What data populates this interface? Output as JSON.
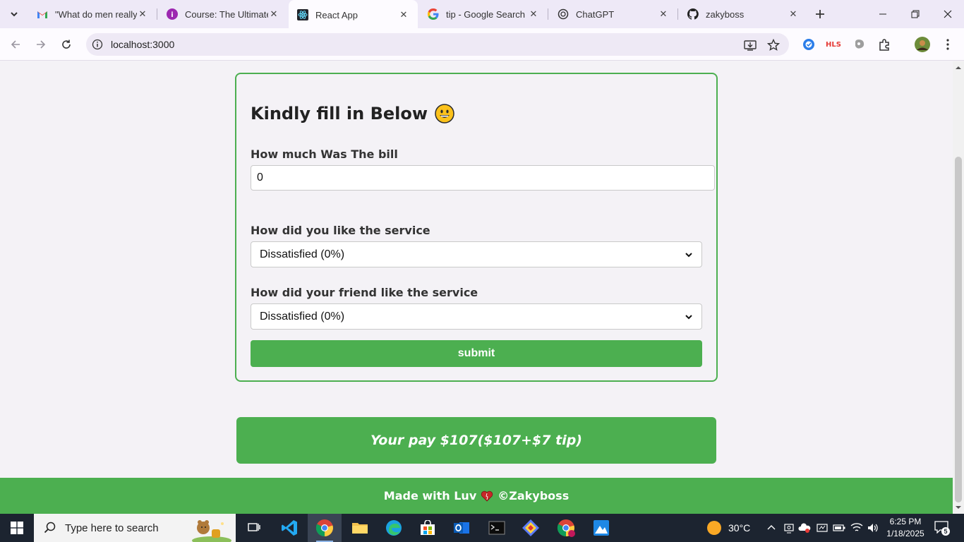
{
  "browser": {
    "tabs": [
      {
        "title": "\"What do men really",
        "favicon": "gmail-icon",
        "active": false
      },
      {
        "title": "Course: The Ultimate",
        "favicon": "course-icon",
        "active": false
      },
      {
        "title": "React App",
        "favicon": "react-icon",
        "active": true
      },
      {
        "title": "tip - Google Search",
        "favicon": "google-icon",
        "active": false
      },
      {
        "title": "ChatGPT",
        "favicon": "chatgpt-icon",
        "active": false
      },
      {
        "title": "zakyboss",
        "favicon": "github-icon",
        "active": false
      }
    ],
    "url": "localhost:3000",
    "extension_label_hls": "HLS"
  },
  "form": {
    "heading": "Kindly fill in Below",
    "bill_label": "How much Was The bill",
    "bill_value": "0",
    "service_label": "How did you like the service",
    "service_value": "Dissatisfied (0%)",
    "friend_label": "How did your friend like the service",
    "friend_value": "Dissatisfied (0%)",
    "submit_label": "submit"
  },
  "result": {
    "text": "Your pay $107($107+$7 tip)"
  },
  "footer": {
    "prefix": "Made with Luv",
    "suffix": "©Zakyboss"
  },
  "taskbar": {
    "search_placeholder": "Type here to search",
    "temperature": "30°C",
    "time": "6:25 PM",
    "date": "1/18/2025",
    "notification_count": "5"
  },
  "colors": {
    "accent_green": "#4caf50",
    "tab_strip": "#eee9f7",
    "taskbar": "#1c2430"
  }
}
